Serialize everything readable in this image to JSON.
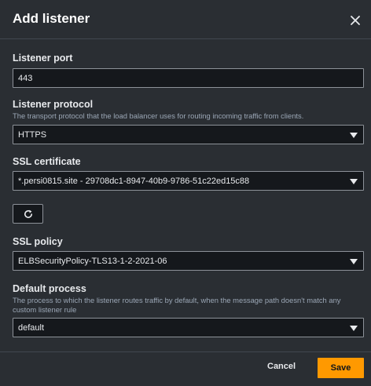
{
  "dialog": {
    "title": "Add listener"
  },
  "port": {
    "label": "Listener port",
    "value": "443"
  },
  "protocol": {
    "label": "Listener protocol",
    "description": "The transport protocol that the load balancer uses for routing incoming traffic from clients.",
    "value": "HTTPS"
  },
  "certificate": {
    "label": "SSL certificate",
    "value": "*.persi0815.site - 29708dc1-8947-40b9-9786-51c22ed15c88"
  },
  "policy": {
    "label": "SSL policy",
    "value": "ELBSecurityPolicy-TLS13-1-2-2021-06"
  },
  "process": {
    "label": "Default process",
    "description": "The process to which the listener routes traffic by default, when the message path doesn't match any custom listener rule",
    "value": "default"
  },
  "footer": {
    "cancel_label": "Cancel",
    "save_label": "Save"
  },
  "colors": {
    "background": "#2a2e33",
    "field": "#15181c",
    "primary": "#ff9900"
  },
  "icons": [
    "close-icon",
    "refresh-icon",
    "chevron-down-icon"
  ]
}
